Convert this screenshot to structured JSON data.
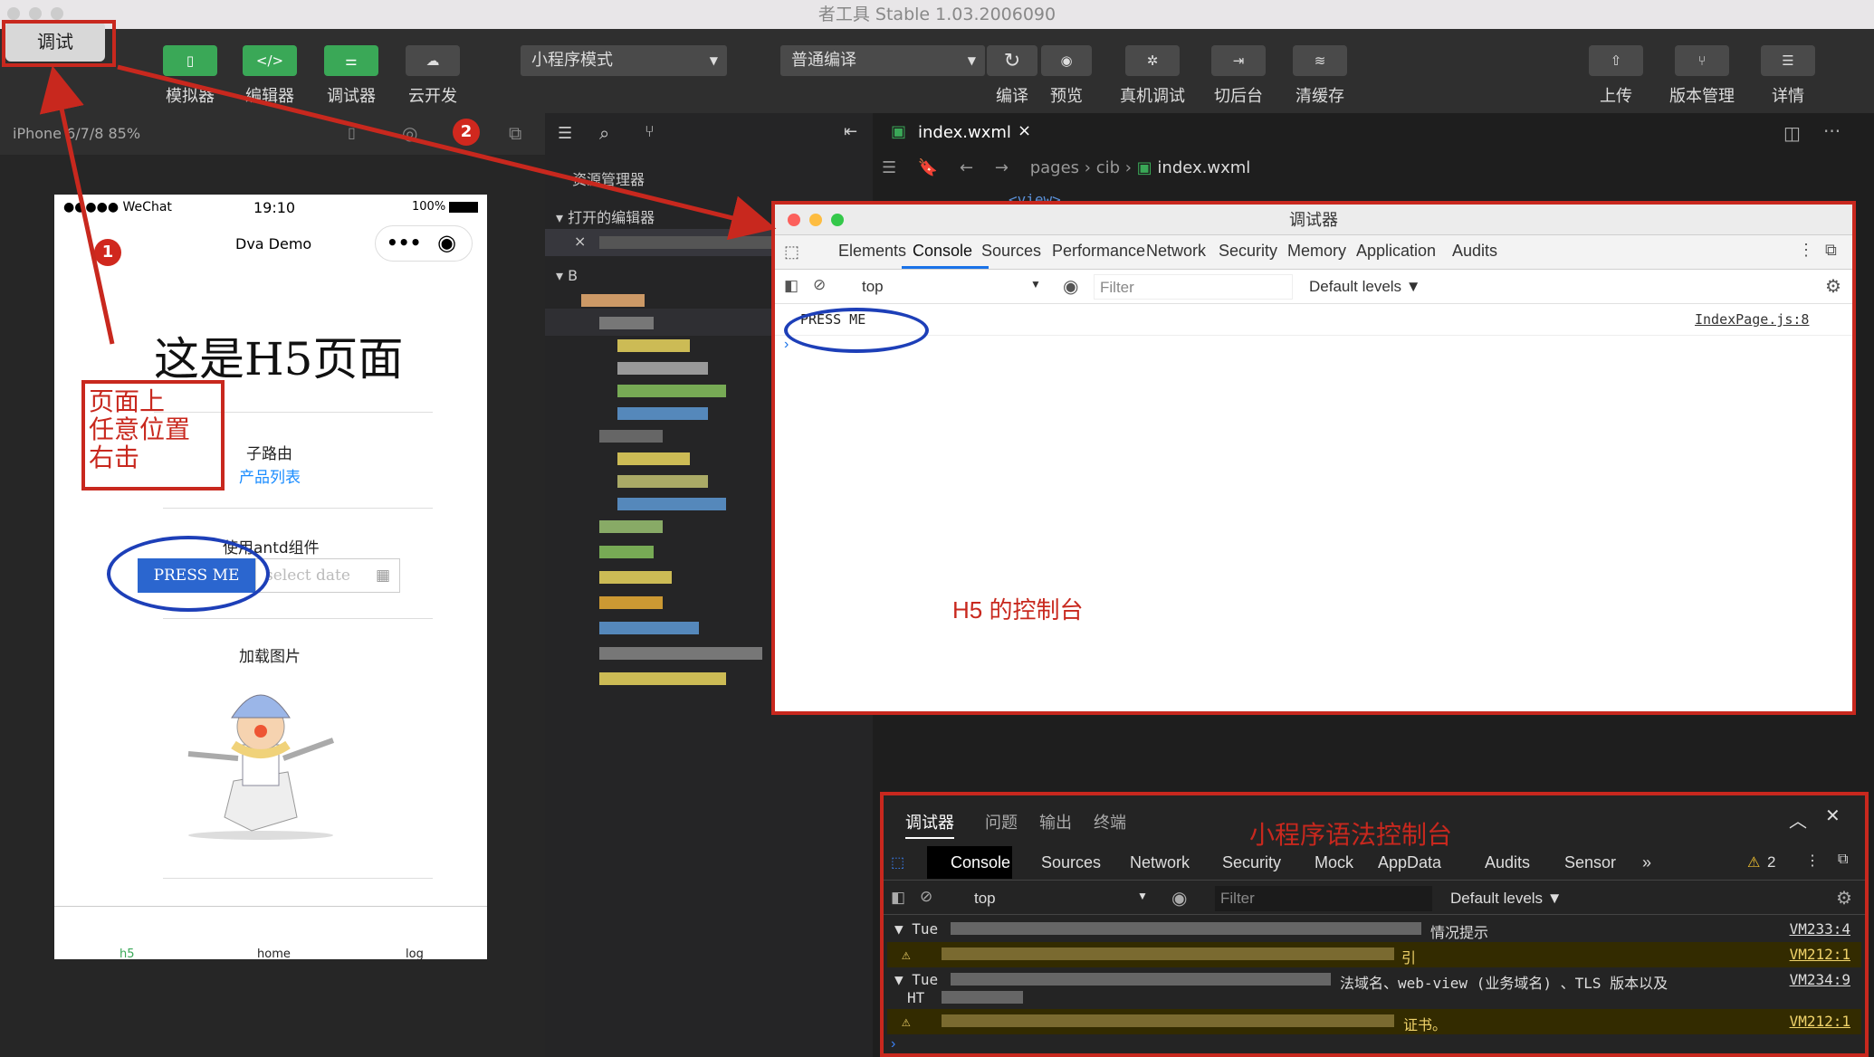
{
  "window": {
    "title": "者工具 Stable 1.03.2006090"
  },
  "debug_tab_label": "调试",
  "toolbar": {
    "simulator": "模拟器",
    "editor": "编辑器",
    "debugger": "调试器",
    "cloud": "云开发",
    "mode_select": "小程序模式",
    "compile_select": "普通编译",
    "compile": "编译",
    "preview": "预览",
    "real_debug": "真机调试",
    "background": "切后台",
    "clear_cache": "清缓存",
    "upload": "上传",
    "version": "版本管理",
    "details": "详情"
  },
  "sim_header": {
    "device": "iPhone 6/7/8 85%"
  },
  "phone": {
    "carrier": "●●●●● WeChat",
    "time": "19:10",
    "battery": "100%",
    "nav_title": "Dva Demo",
    "heading": "这是H5页面",
    "sub_route": "子路由",
    "product_list": "产品列表",
    "antd_label": "使用antd组件",
    "press_btn": "PRESS ME",
    "date_placeholder": "select date",
    "load_img": "加载图片",
    "tabs": [
      "h5",
      "home",
      "log"
    ]
  },
  "explorer": {
    "title": "资源管理器",
    "open_editors": "打开的编辑器"
  },
  "editor": {
    "tab": "index.wxml",
    "crumb_pages": "pages",
    "crumb_cib": "cib",
    "crumb_file": "index.wxml",
    "code": "<view>"
  },
  "h5_devtools": {
    "title": "调试器",
    "tabs": [
      "Elements",
      "Console",
      "Sources",
      "Performance",
      "Network",
      "Security",
      "Memory",
      "Application",
      "Audits"
    ],
    "active_tab": "Console",
    "context": "top",
    "filter_placeholder": "Filter",
    "levels": "Default levels ▼",
    "log_text": "PRESS ME",
    "log_source": "IndexPage.js:8",
    "caption": "H5 的控制台"
  },
  "mini_devtools": {
    "top_tabs": [
      "调试器",
      "问题",
      "输出",
      "终端"
    ],
    "caption": "小程序语法控制台",
    "tabs": [
      "Console",
      "Sources",
      "Network",
      "Security",
      "Mock",
      "AppData",
      "Audits",
      "Sensor",
      "»"
    ],
    "warn_count": "2",
    "context": "top",
    "filter_placeholder": "Filter",
    "levels": "Default levels ▼",
    "rows": [
      {
        "prefix": "▼ Tue",
        "text": "情况提示",
        "src": "VM233:4"
      },
      {
        "prefix": "⚠",
        "text": "引",
        "src": "VM212:1"
      },
      {
        "prefix": "▼ Tue",
        "text": "法域名、web-view (业务域名) 、TLS 版本以及",
        "text2": "HT",
        "src": "VM234:9"
      },
      {
        "prefix": "⚠",
        "text": "证书。",
        "src": "VM212:1"
      }
    ]
  },
  "annotations": {
    "right_click_note": "页面上\n任意位置\n右击",
    "badge1": "1",
    "badge2": "2"
  }
}
